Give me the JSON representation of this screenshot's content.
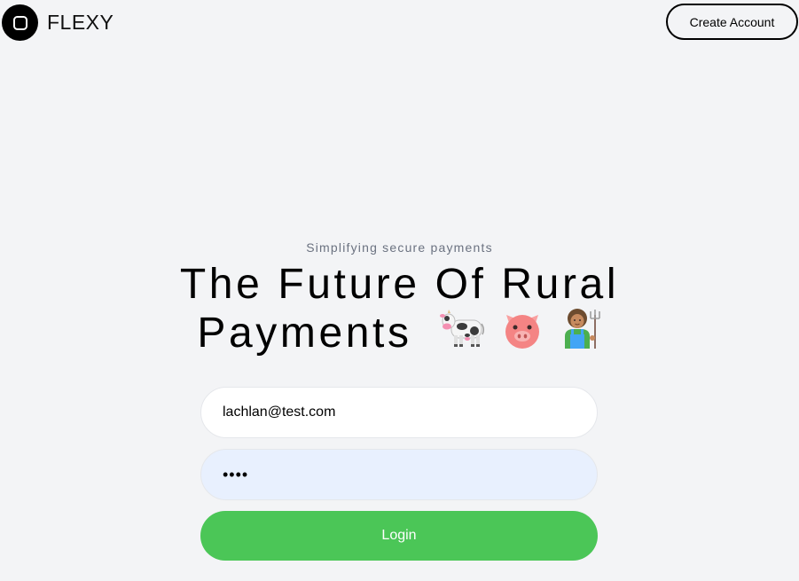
{
  "header": {
    "brand": "FLEXY",
    "logo_icon": "square-logo-icon",
    "create_account_label": "Create Account"
  },
  "hero": {
    "tagline": "Simplifying secure payments",
    "headline_line1": "The Future Of Rural",
    "headline_line2": "Payments",
    "emojis": [
      "cow-emoji",
      "pig-face-emoji",
      "farmer-emoji"
    ]
  },
  "form": {
    "email_value": "lachlan@test.com",
    "password_value": "test",
    "login_label": "Login"
  },
  "colors": {
    "background": "#f3f4f6",
    "primary_button": "#4bc657",
    "autofill_field": "#e8f0fe",
    "subtitle_text": "#6b7280"
  }
}
